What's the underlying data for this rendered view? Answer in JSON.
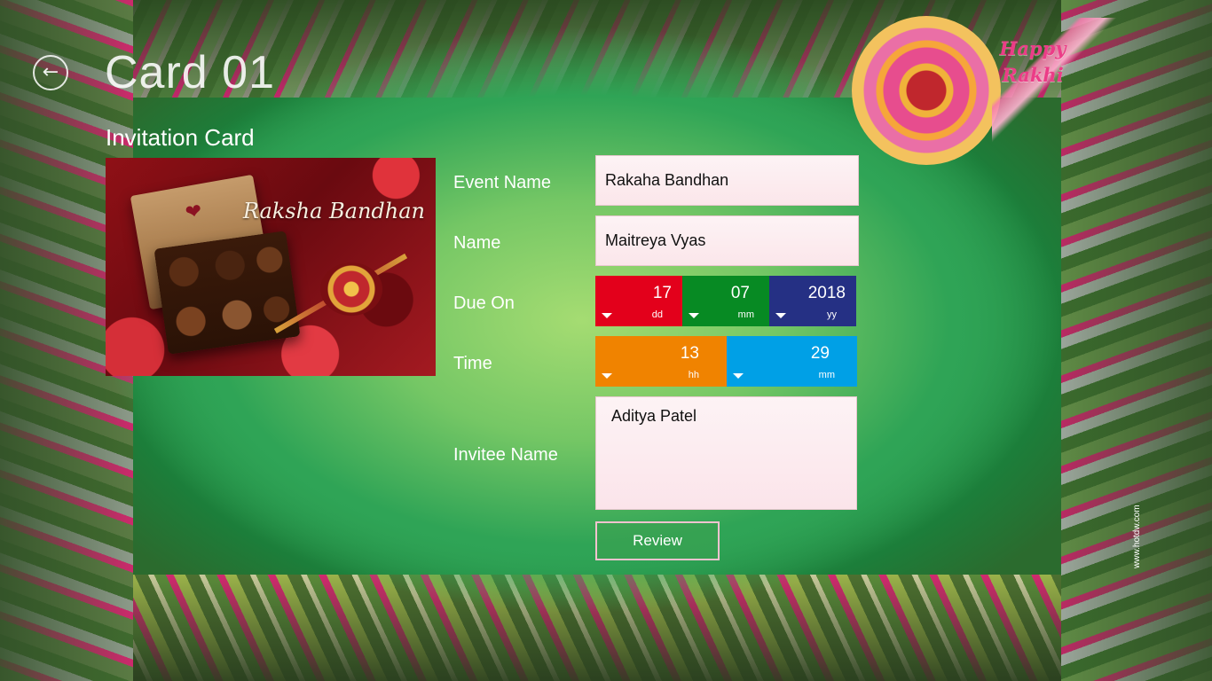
{
  "header": {
    "title": "Card 01",
    "back_icon": "back-arrow-icon"
  },
  "section": {
    "title": "Invitation Card"
  },
  "card": {
    "caption": "Raksha Bandhan"
  },
  "decoration": {
    "line1": "Happy",
    "line2": "Rakhi"
  },
  "form": {
    "event_name_label": "Event Name",
    "event_name_value": "Rakaha Bandhan",
    "name_label": "Name",
    "name_value": "Maitreya Vyas",
    "due_on_label": "Due On",
    "due_day": "17",
    "due_day_unit": "dd",
    "due_month": "07",
    "due_month_unit": "mm",
    "due_year": "2018",
    "due_year_unit": "yy",
    "time_label": "Time",
    "time_hour": "13",
    "time_hour_unit": "hh",
    "time_minute": "29",
    "time_minute_unit": "mm",
    "invitee_label": "Invitee Name",
    "invitee_value": "Aditya Patel",
    "review_label": "Review"
  },
  "watermark": "www.hotdw.com",
  "colors": {
    "day_picker": "#e3001b",
    "month_picker": "#078a23",
    "year_picker": "#253084",
    "hour_picker": "#f08300",
    "minute_picker": "#00a0e6"
  }
}
